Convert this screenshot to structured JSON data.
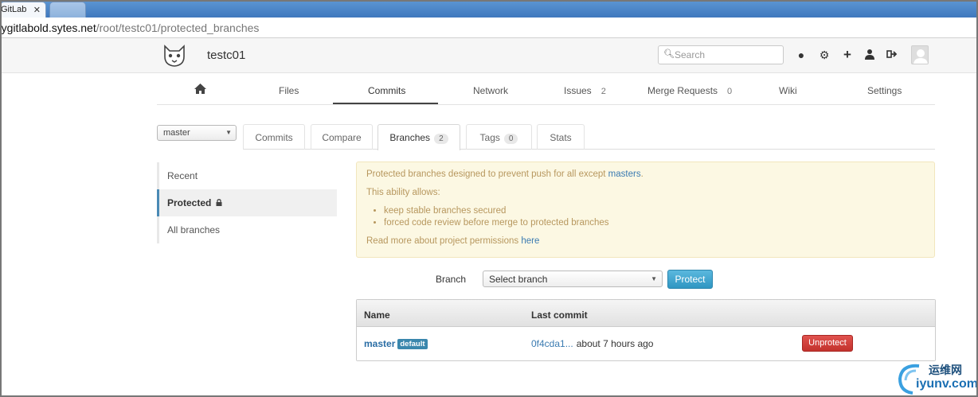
{
  "browser": {
    "tab_title": "GitLab",
    "tab_close": "✕",
    "address_host": "mygitlabold.sytes.net",
    "address_path": "/root/testc01/protected_branches"
  },
  "header": {
    "project_title": "testc01",
    "search_placeholder": "Search",
    "icons": [
      "globe-icon",
      "gears-icon",
      "plus-icon",
      "user-icon",
      "sign-out-icon"
    ]
  },
  "main_nav": {
    "items": [
      {
        "label": "",
        "icon": "home-icon"
      },
      {
        "label": "Files"
      },
      {
        "label": "Commits"
      },
      {
        "label": "Network"
      },
      {
        "label": "Issues",
        "count": "2"
      },
      {
        "label": "Merge Requests",
        "count": "0"
      },
      {
        "label": "Wiki"
      },
      {
        "label": "Settings"
      }
    ],
    "active": "Commits"
  },
  "branch_select": {
    "value": "master"
  },
  "sub_tabs": [
    {
      "label": "Commits"
    },
    {
      "label": "Compare"
    },
    {
      "label": "Branches",
      "count": "2"
    },
    {
      "label": "Tags",
      "count": "0"
    },
    {
      "label": "Stats"
    }
  ],
  "side_nav": {
    "items": [
      {
        "label": "Recent"
      },
      {
        "label": "Protected"
      },
      {
        "label": "All branches"
      }
    ]
  },
  "alert": {
    "intro": "Protected branches designed to prevent push for all except ",
    "intro_link": "masters",
    "intro_end": ".",
    "ability": "This ability allows:",
    "bullets": [
      "keep stable branches secured",
      "forced code review before merge to protected branches"
    ],
    "read_more": "Read more about project permissions ",
    "read_more_link": "here"
  },
  "protect_form": {
    "label": "Branch",
    "select_value": "Select branch",
    "button": "Protect"
  },
  "table": {
    "headers": [
      "Name",
      "Last commit"
    ],
    "rows": [
      {
        "name": "master",
        "badge": "default",
        "sha": "0f4cda1...",
        "time": "about 7 hours ago",
        "action": "Unprotect"
      }
    ]
  },
  "watermark": {
    "cn": "运维网",
    "url": "iyunv.com"
  },
  "colors": {
    "accent": "#3a87ad",
    "danger": "#c3322d",
    "alert_bg": "#fcf8e3"
  }
}
